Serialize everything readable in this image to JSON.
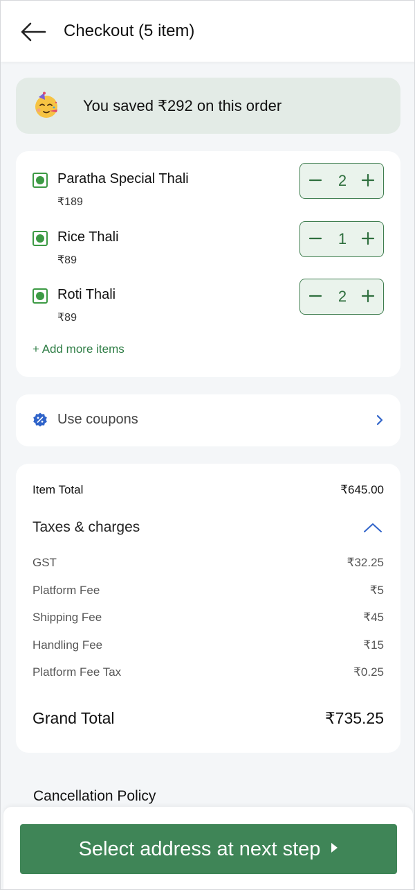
{
  "header": {
    "title": "Checkout (5 item)"
  },
  "savings": {
    "text": "You saved ₹292 on this order"
  },
  "cart": {
    "items": [
      {
        "name": "Paratha Special Thali",
        "price": "₹189",
        "quantity": "2"
      },
      {
        "name": "Rice Thali",
        "price": "₹89",
        "quantity": "1"
      },
      {
        "name": "Roti Thali",
        "price": "₹89",
        "quantity": "2"
      }
    ],
    "add_more_label": "+ Add more items"
  },
  "coupons": {
    "label": "Use coupons"
  },
  "bill": {
    "item_total_label": "Item Total",
    "item_total_value": "₹645.00",
    "taxes_label": "Taxes & charges",
    "fees": [
      {
        "label": "GST",
        "value": "₹32.25"
      },
      {
        "label": "Platform Fee",
        "value": "₹5"
      },
      {
        "label": "Shipping Fee",
        "value": "₹45"
      },
      {
        "label": "Handling Fee",
        "value": "₹15"
      },
      {
        "label": "Platform Fee Tax",
        "value": "₹0.25"
      }
    ],
    "grand_total_label": "Grand Total",
    "grand_total_value": "₹735.25"
  },
  "policy": {
    "title": "Cancellation Policy"
  },
  "footer": {
    "cta_label": "Select address at next step"
  },
  "icons": {
    "back": "back-arrow-icon",
    "party": "party-face-emoji-icon",
    "veg": "veg-indicator-icon",
    "minus": "minus-icon",
    "plus": "plus-icon",
    "coupon": "coupon-badge-icon",
    "chevron": "chevron-right-icon",
    "collapse": "chevron-up-icon",
    "caret": "caret-right-icon"
  },
  "colors": {
    "brand_green": "#3f8557",
    "veg_green": "#3c9a44",
    "savings_bg": "#e3ebe6",
    "page_bg": "#f4f6f8",
    "link_blue": "#2f63c9"
  }
}
